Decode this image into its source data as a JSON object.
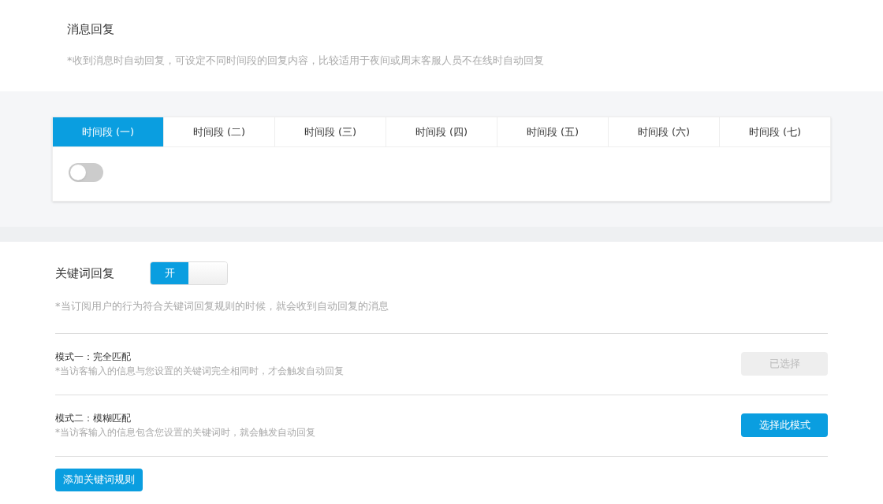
{
  "message_reply": {
    "title": "消息回复",
    "hint": "*收到消息时自动回复，可设定不同时间段的回复内容，比较适用于夜间或周末客服人员不在线时自动回复"
  },
  "periods": {
    "tabs": [
      {
        "label": "时间段 (一)",
        "selected": true
      },
      {
        "label": "时间段 (二)",
        "selected": false
      },
      {
        "label": "时间段 (三)",
        "selected": false
      },
      {
        "label": "时间段 (四)",
        "selected": false
      },
      {
        "label": "时间段 (五)",
        "selected": false
      },
      {
        "label": "时间段 (六)",
        "selected": false
      },
      {
        "label": "时间段 (七)",
        "selected": false
      }
    ],
    "toggle_on": false
  },
  "keyword_reply": {
    "title": "关键词回复",
    "switch": {
      "on": true,
      "label": "开"
    },
    "hint": "*当订阅用户的行为符合关键词回复规则的时候，就会收到自动回复的消息",
    "modes": [
      {
        "title": "模式一：完全匹配",
        "description": "*当访客输入的信息与您设置的关键词完全相同时，才会触发自动回复",
        "selected": true,
        "button": "已选择"
      },
      {
        "title": "模式二：模糊匹配",
        "description": "*当访客输入的信息包含您设置的关键词时，就会触发自动回复",
        "selected": false,
        "button": "选择此模式"
      }
    ],
    "add_button": "添加关键词规则"
  }
}
